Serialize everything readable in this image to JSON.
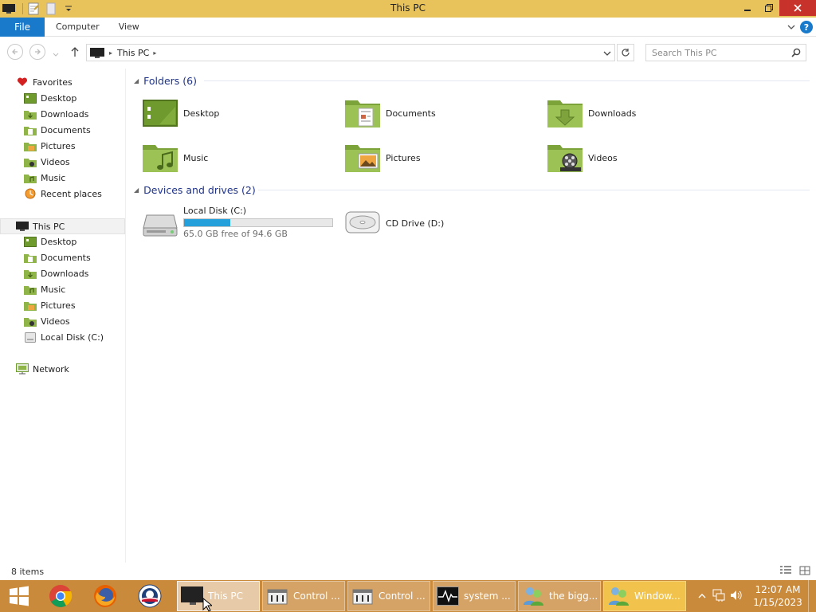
{
  "window": {
    "title": "This PC"
  },
  "ribbon": {
    "file_label": "File",
    "tabs": [
      "Computer",
      "View"
    ]
  },
  "address": {
    "path": "This PC",
    "search_placeholder": "Search This PC"
  },
  "nav": {
    "favorites_label": "Favorites",
    "favorites": [
      "Desktop",
      "Downloads",
      "Documents",
      "Pictures",
      "Videos",
      "Music",
      "Recent places"
    ],
    "this_pc_label": "This PC",
    "this_pc": [
      "Desktop",
      "Documents",
      "Downloads",
      "Music",
      "Pictures",
      "Videos",
      "Local Disk (C:)"
    ],
    "network_label": "Network"
  },
  "content": {
    "folders_header": "Folders (6)",
    "folders": [
      "Desktop",
      "Documents",
      "Downloads",
      "Music",
      "Pictures",
      "Videos"
    ],
    "devices_header": "Devices and drives (2)",
    "drives": [
      {
        "name": "Local Disk (C:)",
        "free_text": "65.0 GB free of 94.6 GB",
        "used_fraction": 0.313
      },
      {
        "name": "CD Drive (D:)"
      }
    ]
  },
  "status": {
    "items_count": "8 items"
  },
  "taskbar": {
    "tasks": [
      "This PC",
      "Control ...",
      "Control ...",
      "system ...",
      "the bigg...",
      "Window..."
    ],
    "time": "12:07 AM",
    "date": "1/15/2023"
  },
  "colors": {
    "titlebar": "#e8c25a",
    "accent": "#1979ca",
    "taskbar": "#c98a3c",
    "folder_green": "#8fb447",
    "drive_fill": "#26a0da"
  }
}
